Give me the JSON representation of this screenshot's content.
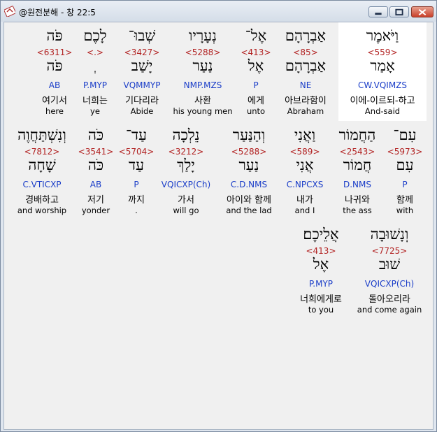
{
  "window": {
    "title": "@원전분해 - 창 22:5",
    "icon": "app-hebrew-icon"
  },
  "words": [
    {
      "heb": "וַיֹּאמֶר",
      "num": "<559>",
      "lemma": "אָמַר",
      "parse": "CW.VQIMZS",
      "kor": "이에-이르되-하고",
      "eng": "And-said",
      "selected": true
    },
    {
      "heb": "אַבְרָהָם",
      "num": "<85>",
      "lemma": "אַבְרָהָם",
      "parse": "NE",
      "kor": "아브라함이",
      "eng": "Abraham"
    },
    {
      "heb": "אֶל־",
      "num": "<413>",
      "lemma": "אֶל",
      "parse": "P",
      "kor": "에게",
      "eng": "unto"
    },
    {
      "heb": "נְעָרָיו",
      "num": "<5288>",
      "lemma": "נַעַר",
      "parse": "NMP.MZS",
      "kor": "사환",
      "eng": "his young men"
    },
    {
      "heb": "שְׁבוּ־",
      "num": "<3427>",
      "lemma": "יָשַׁב",
      "parse": "VQMMYP",
      "kor": "기다리라",
      "eng": "Abide"
    },
    {
      "heb": "לָכֶם",
      "num": "<.>",
      "lemma": "ְ",
      "parse": "P.MYP",
      "kor": "너희는",
      "eng": "ye"
    },
    {
      "heb": "פֹּה",
      "num": "<6311>",
      "lemma": "פֹּה",
      "parse": "AB",
      "kor": "여기서",
      "eng": "here"
    },
    {
      "heb": "עִם־",
      "num": "<5973>",
      "lemma": "עִם",
      "parse": "P",
      "kor": "함께",
      "eng": "with"
    },
    {
      "heb": "הַחֲמוֹר",
      "num": "<2543>",
      "lemma": "חֲמוֹר",
      "parse": "D.NMS",
      "kor": "나귀와",
      "eng": "the ass"
    },
    {
      "heb": "וַאֲנִי",
      "num": "<589>",
      "lemma": "אֲנִי",
      "parse": "C.NPCXS",
      "kor": "내가",
      "eng": "and I"
    },
    {
      "heb": "וְהַנַּעַר",
      "num": "<5288>",
      "lemma": "נַעַר",
      "parse": "C.D.NMS",
      "kor": "아이와 함께",
      "eng": "and the lad"
    },
    {
      "heb": "נֵלְכָה",
      "num": "<3212>",
      "lemma": "יָלַךְ",
      "parse": "VQICXP(Ch)",
      "kor": "가서",
      "eng": "will go"
    },
    {
      "heb": "עַד־",
      "num": "<5704>",
      "lemma": "עַד",
      "parse": "P",
      "kor": "까지",
      "eng": "."
    },
    {
      "heb": "כֹּה",
      "num": "<3541>",
      "lemma": "כֹּה",
      "parse": "AB",
      "kor": "저기",
      "eng": "yonder"
    },
    {
      "heb": "וְנִשְׁתַּחֲוֶה",
      "num": "<7812>",
      "lemma": "שָׁחָה",
      "parse": "C.VTICXP",
      "kor": "경배하고",
      "eng": "and worship"
    },
    {
      "heb": "וְנָשׁוּבָה",
      "num": "<7725>",
      "lemma": "שׁוּב",
      "parse": "VQICXP(Ch)",
      "kor": "돌아오리라",
      "eng": "and come again"
    },
    {
      "heb": "אֲלֵיכֶם׃",
      "num": "<413>",
      "lemma": "אֶל",
      "parse": "P.MYP",
      "kor": "너희에게로",
      "eng": "to you"
    }
  ]
}
